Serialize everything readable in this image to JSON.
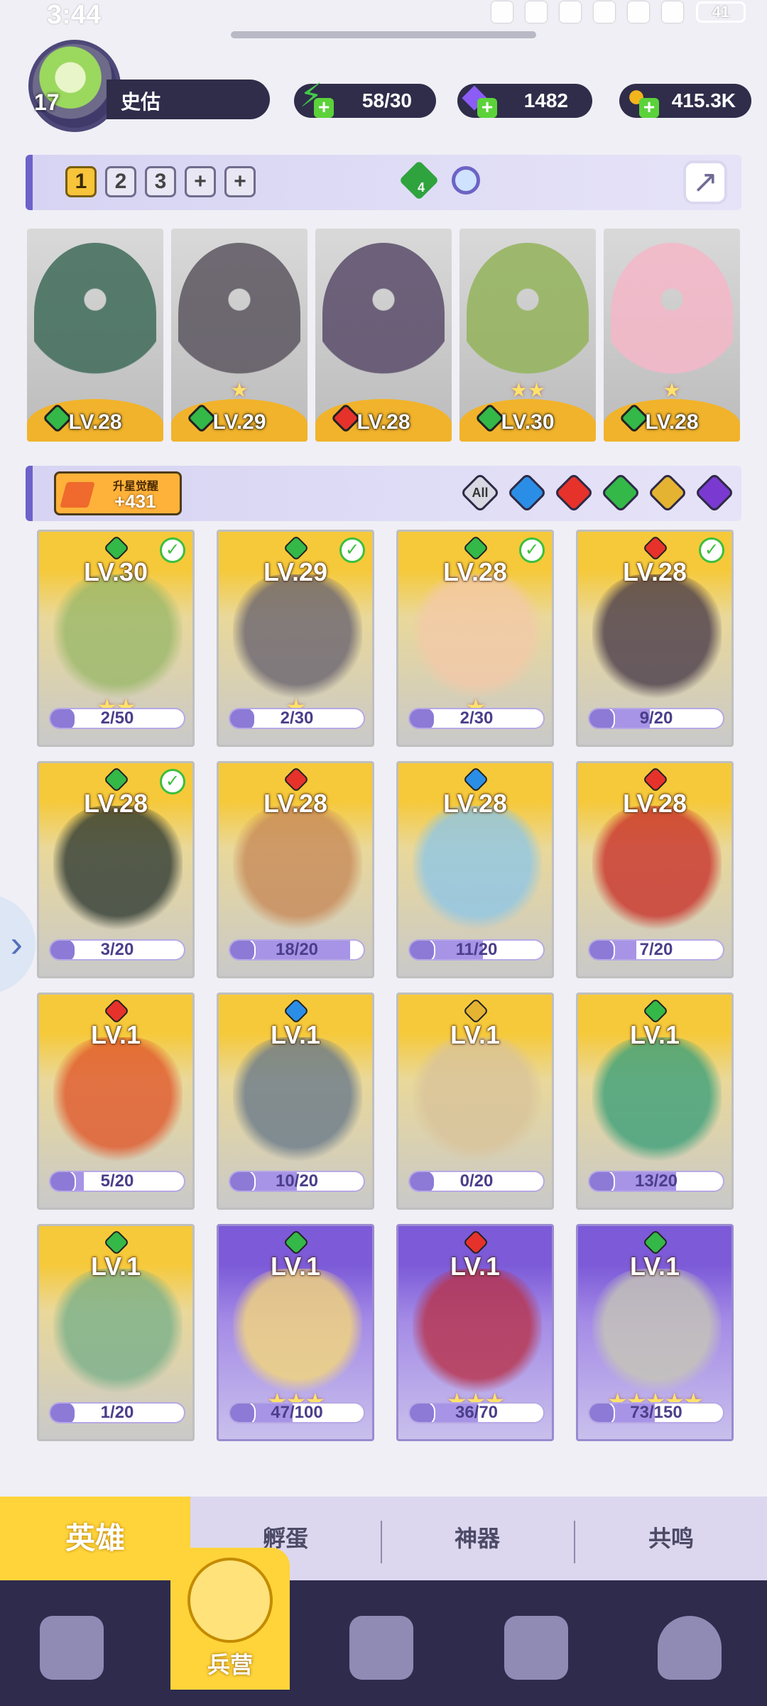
{
  "status_bar": {
    "time": "3:44",
    "battery": "41"
  },
  "player": {
    "level": "17",
    "name": "史估"
  },
  "resources": [
    {
      "icon": "lightning-icon",
      "value": "58/30",
      "color": "#43c94a"
    },
    {
      "icon": "diamond-icon",
      "value": "1482",
      "color": "#8b5cf6"
    },
    {
      "icon": "coin-icon",
      "value": "415.3K",
      "color": "#f2b51d"
    }
  ],
  "team_tabs": [
    "1",
    "2",
    "3",
    "+",
    "+"
  ],
  "team_gem_count": "4",
  "team": [
    {
      "level": "LV.28",
      "element": "grass",
      "stars": "",
      "art_color": "#3f6b5a"
    },
    {
      "level": "LV.29",
      "element": "grass",
      "stars": "★",
      "art_color": "#5c5660"
    },
    {
      "level": "LV.28",
      "element": "fire",
      "stars": "",
      "art_color": "#5a4c6a"
    },
    {
      "level": "LV.30",
      "element": "grass",
      "stars": "★★",
      "art_color": "#93b35a"
    },
    {
      "level": "LV.28",
      "element": "grass",
      "stars": "★",
      "art_color": "#f5b7c8"
    }
  ],
  "awaken": {
    "title": "升星觉醒",
    "value": "+431"
  },
  "filters": [
    "All",
    "water",
    "fire",
    "grass",
    "light",
    "dark"
  ],
  "heroes": [
    {
      "level": "LV.30",
      "element": "grass",
      "checked": true,
      "stars": "★★",
      "progress": "2/50",
      "frac": 0.04,
      "style": "gold",
      "art": "#9ab86a"
    },
    {
      "level": "LV.29",
      "element": "grass",
      "checked": true,
      "stars": "★",
      "progress": "2/30",
      "frac": 0.07,
      "style": "gold",
      "art": "#6a6470"
    },
    {
      "level": "LV.28",
      "element": "grass",
      "checked": true,
      "stars": "★",
      "progress": "2/30",
      "frac": 0.07,
      "style": "gold",
      "art": "#f3c9a8"
    },
    {
      "level": "LV.28",
      "element": "fire",
      "checked": true,
      "stars": "",
      "progress": "9/20",
      "frac": 0.45,
      "style": "gold",
      "art": "#4a3c4a"
    },
    {
      "level": "LV.28",
      "element": "grass",
      "checked": true,
      "stars": "",
      "progress": "3/20",
      "frac": 0.15,
      "style": "gold",
      "art": "#2f3a33"
    },
    {
      "level": "LV.28",
      "element": "fire",
      "checked": false,
      "stars": "",
      "progress": "18/20",
      "frac": 0.9,
      "style": "gold",
      "art": "#c78a5a"
    },
    {
      "level": "LV.28",
      "element": "water",
      "checked": false,
      "stars": "",
      "progress": "11/20",
      "frac": 0.55,
      "style": "gold",
      "art": "#8fc6e6"
    },
    {
      "level": "LV.28",
      "element": "fire",
      "checked": false,
      "stars": "",
      "progress": "7/20",
      "frac": 0.35,
      "style": "gold",
      "art": "#c8322c"
    },
    {
      "level": "LV.1",
      "element": "fire",
      "checked": false,
      "stars": "",
      "progress": "5/20",
      "frac": 0.25,
      "style": "gold",
      "art": "#e0582c"
    },
    {
      "level": "LV.1",
      "element": "water",
      "checked": false,
      "stars": "",
      "progress": "10/20",
      "frac": 0.5,
      "style": "gold",
      "art": "#6a7a8a"
    },
    {
      "level": "LV.1",
      "element": "light",
      "checked": false,
      "stars": "",
      "progress": "0/20",
      "frac": 0.0,
      "style": "gold",
      "art": "#d9c39a"
    },
    {
      "level": "LV.1",
      "element": "grass",
      "checked": false,
      "stars": "",
      "progress": "13/20",
      "frac": 0.65,
      "style": "gold",
      "art": "#3ca07a"
    },
    {
      "level": "LV.1",
      "element": "grass",
      "checked": false,
      "stars": "",
      "progress": "1/20",
      "frac": 0.05,
      "style": "gold",
      "art": "#7ab08a"
    },
    {
      "level": "LV.1",
      "element": "grass",
      "checked": false,
      "stars": "★★★",
      "progress": "47/100",
      "frac": 0.47,
      "style": "purple",
      "art": "#f4d77a"
    },
    {
      "level": "LV.1",
      "element": "fire",
      "checked": false,
      "stars": "★★★",
      "progress": "36/70",
      "frac": 0.51,
      "style": "purple",
      "art": "#b8324a"
    },
    {
      "level": "LV.1",
      "element": "grass",
      "checked": false,
      "stars": "★★★★★",
      "progress": "73/150",
      "frac": 0.49,
      "style": "purple",
      "art": "#c6c6b6"
    }
  ],
  "sub_tabs": [
    "英雄",
    "孵蛋",
    "神器",
    "共鸣"
  ],
  "bottom_nav": {
    "active_label": "兵营"
  }
}
